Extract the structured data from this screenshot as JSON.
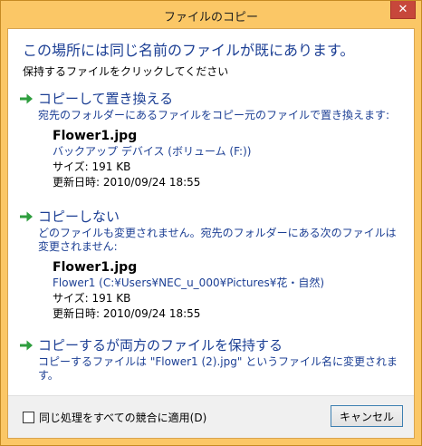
{
  "window": {
    "title": "ファイルのコピー",
    "close_label": "✕"
  },
  "header": {
    "heading": "この場所には同じ名前のファイルが既にあります。",
    "subheading": "保持するファイルをクリックしてください"
  },
  "options": [
    {
      "title": "コピーして置き換える",
      "description": "宛先のフォルダーにあるファイルをコピー元のファイルで置き換えます:",
      "file": {
        "name": "Flower1.jpg",
        "location": "バックアップ デバイス (ボリューム (F:))",
        "size": "サイズ: 191 KB",
        "modified": "更新日時: 2010/09/24 18:55"
      }
    },
    {
      "title": "コピーしない",
      "description": "どのファイルも変更されません。宛先のフォルダーにある次のファイルは変更されません:",
      "file": {
        "name": "Flower1.jpg",
        "location": "Flower1 (C:¥Users¥NEC_u_000¥Pictures¥花・自然)",
        "size": "サイズ: 191 KB",
        "modified": "更新日時: 2010/09/24 18:55"
      }
    },
    {
      "title": "コピーするが両方のファイルを保持する",
      "description": "コピーするファイルは \"Flower1 (2).jpg\" というファイル名に変更されます。"
    }
  ],
  "footer": {
    "checkbox_label": "同じ処理をすべての競合に適用(D)",
    "checkbox_checked": false,
    "cancel_label": "キャンセル"
  },
  "colors": {
    "titlebar": "#fbc766",
    "link_blue": "#1c3f94",
    "arrow_green": "#2e9e3e",
    "close_red": "#c7473b"
  },
  "icons": {
    "option_arrow": "green-arrow-icon",
    "close": "close-icon"
  }
}
